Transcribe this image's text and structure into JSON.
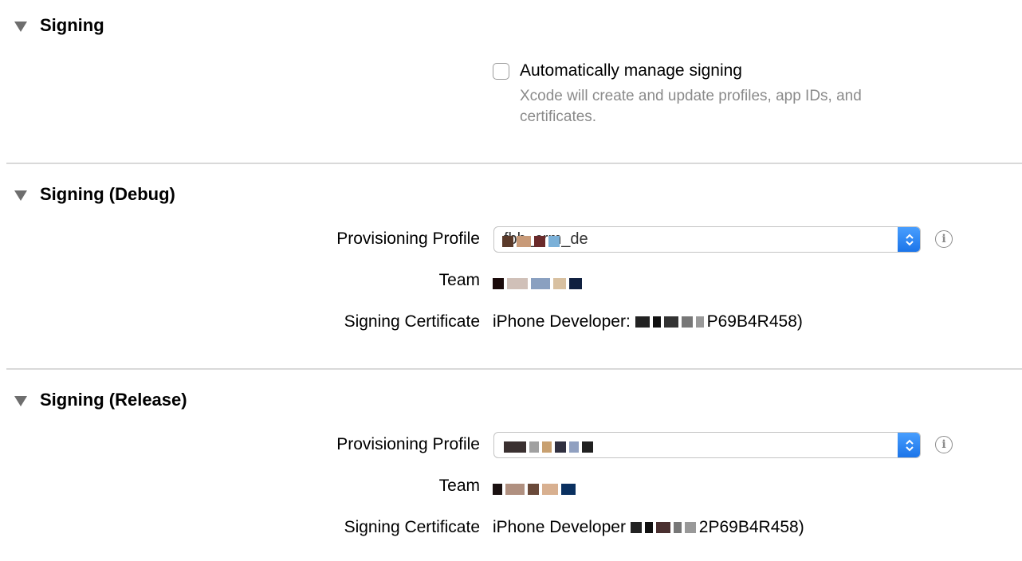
{
  "sections": {
    "signing": {
      "title": "Signing",
      "auto_label": "Automatically manage signing",
      "auto_desc": "Xcode will create and update profiles, app IDs, and certificates.",
      "auto_checked": false
    },
    "debug": {
      "title": "Signing (Debug)",
      "profile_label": "Provisioning Profile",
      "profile_value": "fbb_crm_de",
      "team_label": "Team",
      "cert_label": "Signing Certificate",
      "cert_prefix": "iPhone Developer:",
      "cert_suffix": "P69B4R458)"
    },
    "release": {
      "title": "Signing (Release)",
      "profile_label": "Provisioning Profile",
      "team_label": "Team",
      "cert_label": "Signing Certificate",
      "cert_prefix": "iPhone Developer",
      "cert_suffix": "2P69B4R458)"
    }
  },
  "colors": {
    "accent": "#1a73e8",
    "divider": "#d9d9d9",
    "secondary_text": "#8a8a8a"
  },
  "icons": [
    "disclosure-triangle-icon",
    "checkbox-icon",
    "stepper-icon",
    "info-icon"
  ]
}
